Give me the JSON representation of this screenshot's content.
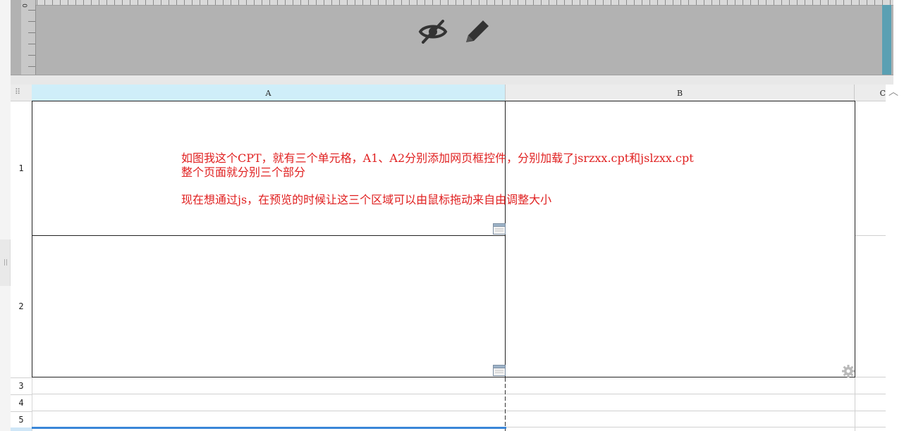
{
  "ruler": {
    "zero_label": "0"
  },
  "toolbar": {
    "hide_icon": "eye-slash-icon",
    "edit_icon": "pencil-icon"
  },
  "sidebar": {
    "handle_label": "||"
  },
  "grid": {
    "corner_icon": "⠿",
    "columns": [
      "A",
      "B",
      "C"
    ],
    "rows": [
      "1",
      "2",
      "3",
      "4",
      "5"
    ]
  },
  "annotation": {
    "line1": "如图我这个CPT，就有三个单元格，A1、A2分别添加网页框控件，分别加载了jsrzxx.cpt和jslzxx.cpt",
    "line2": "整个页面就分别三个部分",
    "line3": "现在想通过js，在预览的时候让这三个区域可以由鼠标拖动来自由调整大小"
  },
  "scrollbar": {
    "up_label": "︿"
  },
  "colors": {
    "header_bg": "#b2b2b2",
    "selected_column": "#cfeef9",
    "annotation": "#e02020",
    "selection": "#3a86d8",
    "teal_accent": "#5aa0b3"
  }
}
